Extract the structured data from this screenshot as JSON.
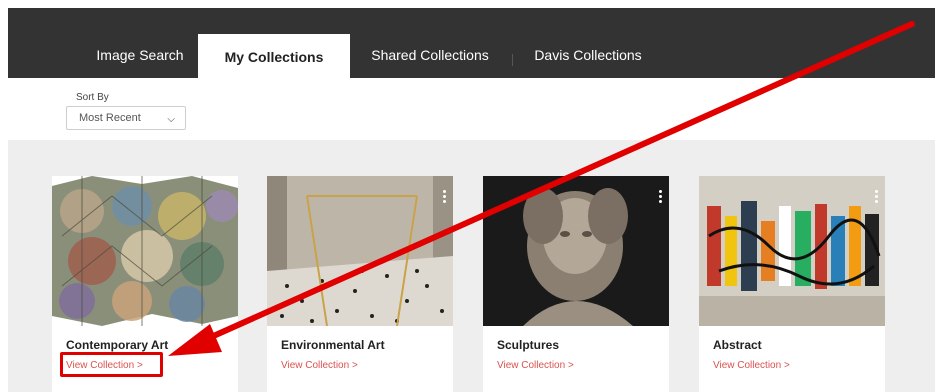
{
  "tabs": {
    "image_search": "Image Search",
    "my_collections": "My Collections",
    "shared_collections": "Shared Collections",
    "davis_collections": "Davis Collections"
  },
  "sort": {
    "label": "Sort By",
    "selected": "Most Recent"
  },
  "collections": [
    {
      "title": "Contemporary Art",
      "link": "View Collection >"
    },
    {
      "title": "Environmental Art",
      "link": "View Collection >"
    },
    {
      "title": "Sculptures",
      "link": "View Collection >"
    },
    {
      "title": "Abstract",
      "link": "View Collection >"
    }
  ],
  "colors": {
    "tabbar": "#333333",
    "link": "#d9534f",
    "annotation": "#e00000",
    "grid_bg": "#eeeeee"
  },
  "icons": [
    "chevron-down-icon",
    "more-vertical-icon",
    "annotation-arrow"
  ]
}
